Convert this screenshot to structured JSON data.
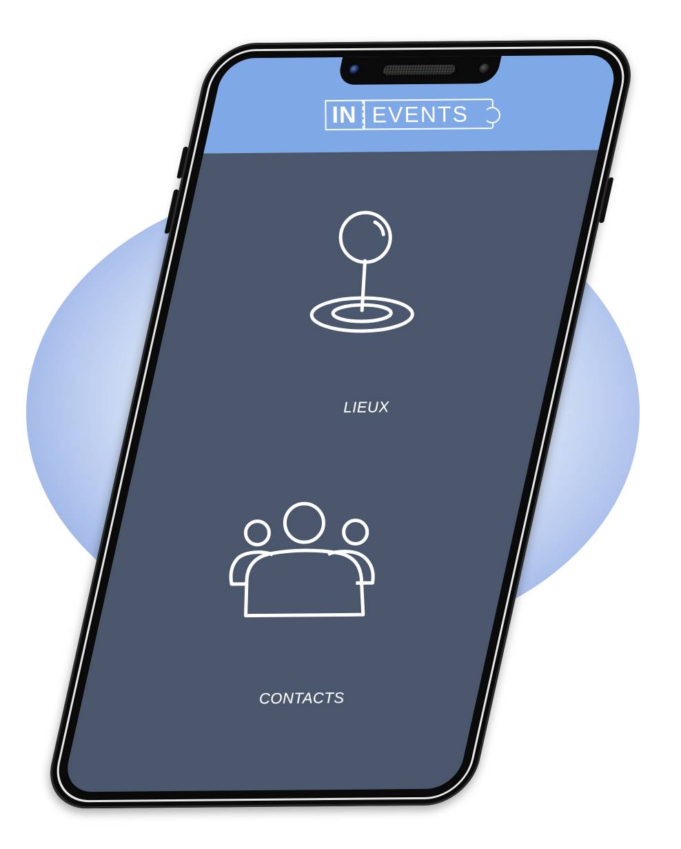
{
  "app": {
    "logo": {
      "in": "IN",
      "events": "EVENTS"
    }
  },
  "menu": {
    "items": [
      {
        "label": "LIEUX",
        "icon": "map-pin-icon"
      },
      {
        "label": "CONTACTS",
        "icon": "group-icon"
      }
    ]
  },
  "colors": {
    "header": "#7fa8e6",
    "screen": "#4a566c",
    "frame": "#0a0a0a",
    "icon_stroke": "#ffffff"
  }
}
